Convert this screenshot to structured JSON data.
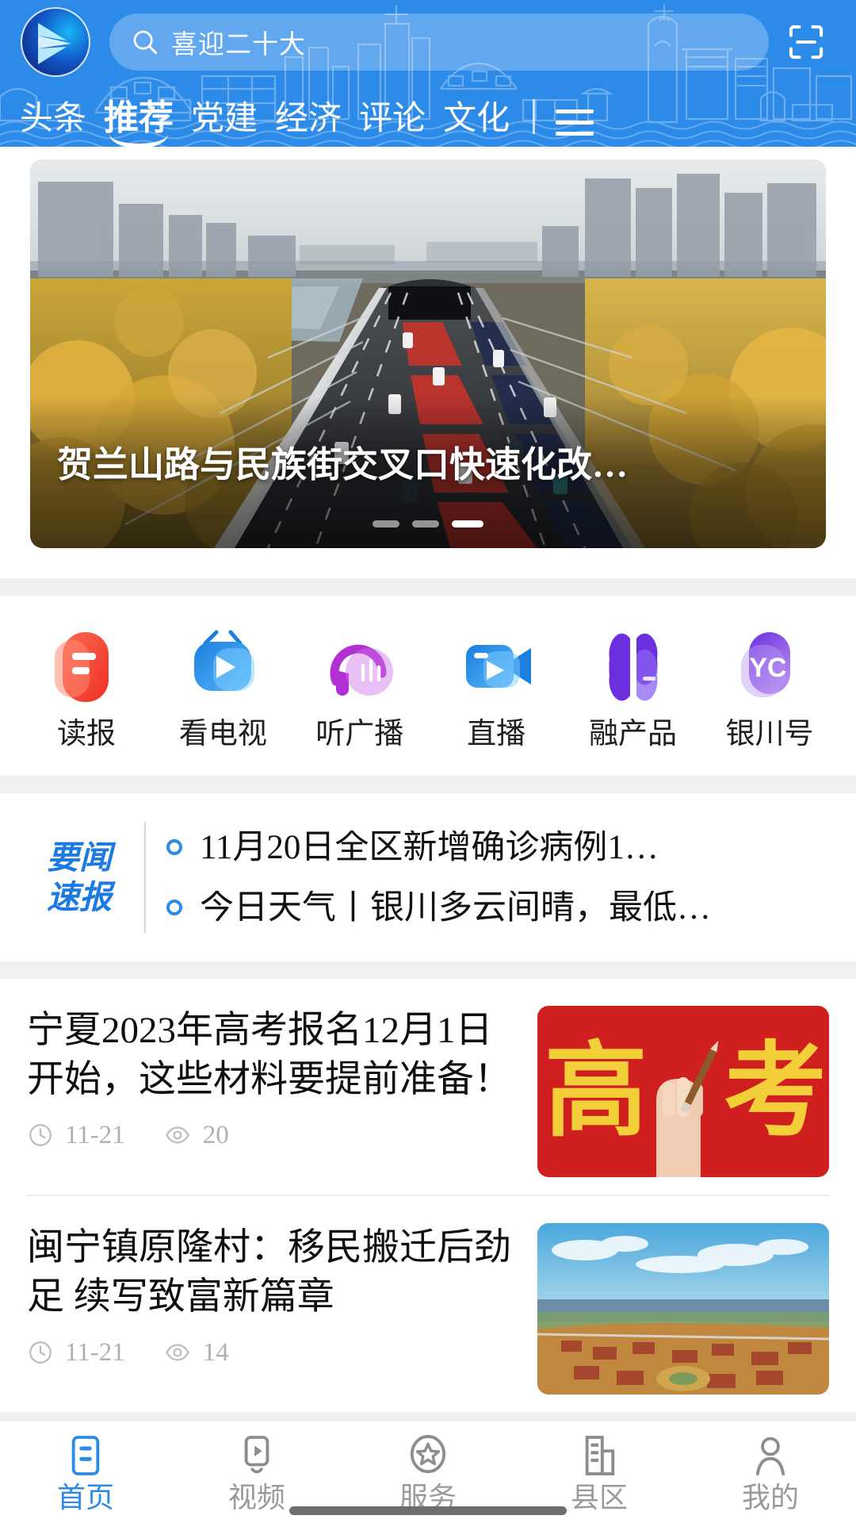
{
  "header": {
    "logo_name": "yinchuan-app-logo",
    "search": {
      "placeholder": "喜迎二十大",
      "icon": "search-icon"
    },
    "scan_icon": "scan-qr-icon",
    "menu_icon": "hamburger-menu-icon",
    "accent_color": "#2c8ae8"
  },
  "tabs": [
    {
      "label": "头条",
      "active": false
    },
    {
      "label": "推荐",
      "active": true
    },
    {
      "label": "党建",
      "active": false
    },
    {
      "label": "经济",
      "active": false
    },
    {
      "label": "评论",
      "active": false
    },
    {
      "label": "文化",
      "active": false
    }
  ],
  "hero": {
    "caption": "贺兰山路与民族街交叉口快速化改…",
    "image_alt": "aerial-view-of-expressway-with-autumn-trees",
    "dots_total": 3,
    "dots_active_index": 2
  },
  "shortcuts": [
    {
      "label": "读报",
      "icon": "newspaper-icon",
      "color": "#f4523b"
    },
    {
      "label": "看电视",
      "icon": "television-icon",
      "color": "#2a8ce8"
    },
    {
      "label": "听广播",
      "icon": "radio-headphone-icon",
      "color": "#b22fd6"
    },
    {
      "label": "直播",
      "icon": "video-camera-icon",
      "color": "#2a8ce8"
    },
    {
      "label": "融产品",
      "icon": "four-leaf-grid-icon",
      "color": "#6b2fe0"
    },
    {
      "label": "银川号",
      "icon": "yc-badge-icon",
      "color": "#7b3ae8",
      "badge_text": "YC"
    }
  ],
  "ticker": {
    "badge_line1": "要闻",
    "badge_line2": "速报",
    "badge_color": "#1d7ae0",
    "items": [
      {
        "text": "11月20日全区新增确诊病例1…"
      },
      {
        "text": "今日天气丨银川多云间晴，最低…"
      }
    ]
  },
  "news": [
    {
      "title": "宁夏2023年高考报名12月1日开始，这些材料要提前准备！",
      "date": "11-21",
      "views": "20",
      "thumb_alt": "hand-holding-pencil-over-gaokao-red-banner",
      "clock_icon": "clock-icon",
      "eye_icon": "eye-icon"
    },
    {
      "title": "闽宁镇原隆村：移民搬迁后劲足 续写致富新篇章",
      "date": "11-21",
      "views": "14",
      "thumb_alt": "aerial-view-of-village-under-blue-sky",
      "clock_icon": "clock-icon",
      "eye_icon": "eye-icon"
    }
  ],
  "bottom_nav": [
    {
      "label": "首页",
      "icon": "home-document-icon",
      "active": true
    },
    {
      "label": "视频",
      "icon": "video-play-icon",
      "active": false
    },
    {
      "label": "服务",
      "icon": "star-service-icon",
      "active": false
    },
    {
      "label": "县区",
      "icon": "buildings-icon",
      "active": false
    },
    {
      "label": "我的",
      "icon": "person-profile-icon",
      "active": false
    }
  ]
}
